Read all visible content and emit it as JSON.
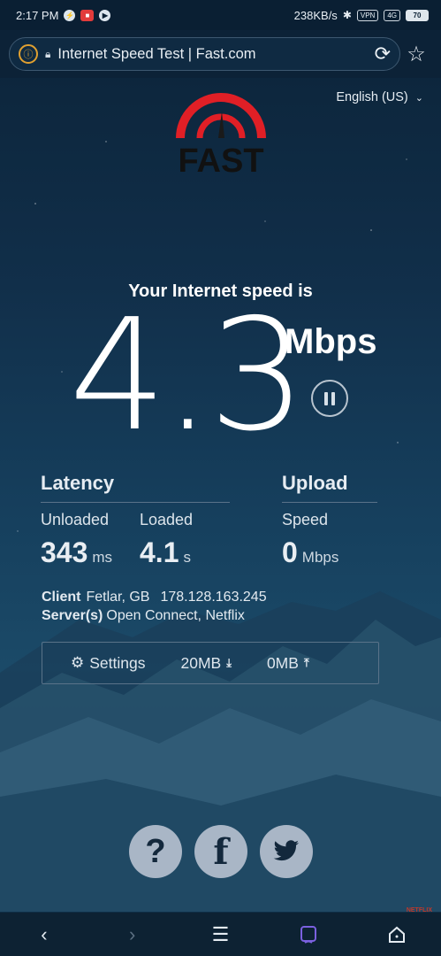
{
  "status_bar": {
    "time": "2:17 PM",
    "speed": "238KB/s",
    "vpn": "VPN",
    "network": "4G",
    "battery": "70"
  },
  "address_bar": {
    "title": "Internet Speed Test | Fast.com"
  },
  "language": "English (US)",
  "logo_text": "FAST",
  "speed": {
    "heading": "Your Internet speed is",
    "value": "4.3",
    "unit": "Mbps"
  },
  "latency": {
    "title": "Latency",
    "unloaded_label": "Unloaded",
    "unloaded_value": "343",
    "unloaded_unit": "ms",
    "loaded_label": "Loaded",
    "loaded_value": "4.1",
    "loaded_unit": "s"
  },
  "upload": {
    "title": "Upload",
    "speed_label": "Speed",
    "speed_value": "0",
    "speed_unit": "Mbps"
  },
  "client": {
    "label": "Client",
    "location": "Fetlar, GB",
    "ip": "178.128.163.245",
    "servers_label": "Server(s)",
    "servers": "Open Connect, Netflix"
  },
  "settings": {
    "label": "Settings",
    "download_size": "20MB",
    "upload_size": "0MB"
  },
  "social": {
    "help": "?",
    "facebook": "f"
  },
  "footer_tag": "NETFLIX",
  "colors": {
    "accent_red": "#e01f26",
    "background": "#133450",
    "social_button": "#a9b6c6",
    "nav_active": "#7b61e0"
  }
}
